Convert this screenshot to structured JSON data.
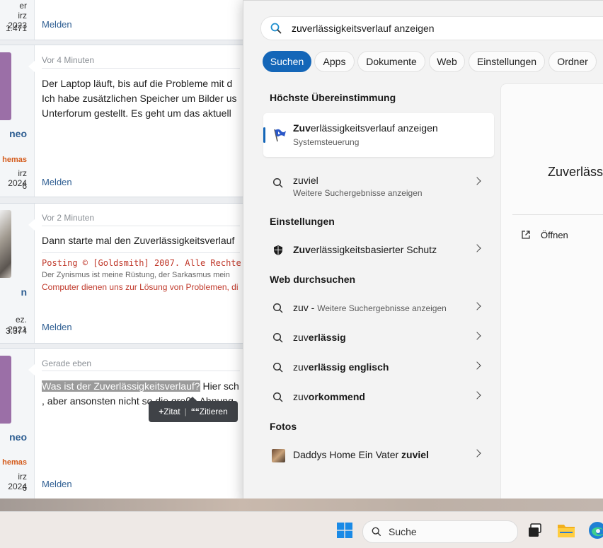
{
  "forum": {
    "posts": [
      {
        "user_stat_1": "er",
        "user_stat_2": "irz 2023",
        "user_stat_3": "1.471",
        "action": "Melden"
      },
      {
        "time": "Vor 4 Minuten",
        "text": [
          "Der Laptop läuft, bis auf die Probleme mit d",
          "Ich habe zusätzlichen Speicher um Bilder us",
          "Unterforum gestellt. Es geht um das aktuell"
        ],
        "user_name": "neo",
        "user_title": "hemas",
        "user_date": "irz 2024",
        "user_count": "6",
        "action": "Melden"
      },
      {
        "time": "Vor 2 Minuten",
        "text": "Dann starte mal den Zuverlässigkeitsverlauf",
        "signature_1": "Posting © [Goldsmith] 2007. Alle Rechte vorbehalte",
        "signature_2": "Der Zynismus ist meine Rüstung, der Sarkasmus mein",
        "signature_3": "Computer dienen uns zur Lösung von Problemen, di",
        "user_name": "n",
        "user_date": "ez. 2021",
        "user_count": "3.374",
        "action": "Melden"
      },
      {
        "time": "Gerade eben",
        "text_highlight": "Was ist der Zuverlässigkeitsverlauf?",
        "text_rest": " Hier sch",
        "text_line2": ", aber ansonsten nicht so die große Ahnung",
        "user_name": "neo",
        "user_title": "hemas",
        "user_date": "irz 2024",
        "user_count": "6",
        "action": "Melden"
      }
    ],
    "quote_tooltip": {
      "zitat": "Zitat",
      "separator": "|",
      "zitieren": "Zitieren"
    }
  },
  "search": {
    "query_bold": "zuv",
    "query_rest": "erlässigkeitsverlauf anzeigen",
    "chips": [
      "Suchen",
      "Apps",
      "Dokumente",
      "Web",
      "Einstellungen",
      "Ordner"
    ],
    "active_chip": "Suchen",
    "best_match_header": "Höchste Übereinstimmung",
    "best_match": {
      "title_bold": "Zuv",
      "title_rest": "erlässigkeitsverlauf anzeigen",
      "subtitle": "Systemsteuerung"
    },
    "zuviel": {
      "bold": "zuviel",
      "sub": "Weitere Suchergebnisse anzeigen"
    },
    "settings_header": "Einstellungen",
    "settings_item": {
      "bold": "Zuv",
      "rest": "erlässigkeitsbasierter Schutz"
    },
    "web_header": "Web durchsuchen",
    "web_items": [
      {
        "bold": "zuv",
        "rest": " - ",
        "sub": "Weitere Suchergebnisse anzeigen"
      },
      {
        "pre": "zuv",
        "bold": "erlässig",
        "rest": ""
      },
      {
        "pre": "zuv",
        "bold": "erlässig englisch",
        "rest": ""
      },
      {
        "pre": "zuv",
        "bold": "orkommend",
        "rest": ""
      }
    ],
    "photos_header": "Fotos",
    "photo_item": {
      "pre": "Daddys Home Ein Vater ",
      "bold": "zuviel"
    },
    "preview": {
      "title": "Zuverlässi",
      "open_label": "Öffnen"
    }
  },
  "taskbar": {
    "search_label": "Suche"
  },
  "colors": {
    "accent": "#1466b8",
    "forum_link": "#2e5e92",
    "forum_title": "#d45a1a",
    "signature_red": "#c0392b"
  }
}
